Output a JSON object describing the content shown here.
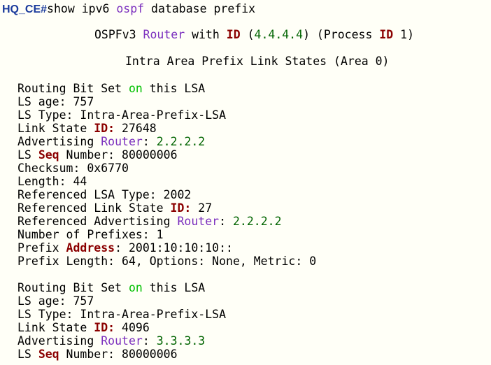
{
  "window": {
    "background": "#fffff7"
  },
  "colors": {
    "prompt": "#1a3a9c",
    "keyword_green": "#00c000",
    "keyword_purple": "#7b2fbe",
    "keyword_maroon": "#8b0000",
    "value_darkgreen": "#006400",
    "text": "#000000"
  },
  "terminal": {
    "lines": [
      {
        "name": "command-line",
        "segs": [
          {
            "t": "HQ_CE#",
            "c": "prompt"
          },
          {
            "t": "show ipv6 "
          },
          {
            "t": "ospf",
            "c": "purple"
          },
          {
            "t": " database prefix"
          }
        ]
      },
      {
        "name": "header-router-line",
        "segs": [
          {
            "t": "OSPFv3 "
          },
          {
            "t": "Router",
            "c": "purple"
          },
          {
            "t": " with "
          },
          {
            "t": "ID",
            "c": "maroon",
            "b": true
          },
          {
            "t": " ("
          },
          {
            "t": "4.4.4.4",
            "c": "darkgreen"
          },
          {
            "t": ") (Process "
          },
          {
            "t": "ID",
            "c": "maroon",
            "b": true
          },
          {
            "t": " 1)"
          }
        ]
      },
      {
        "name": "header-area-line",
        "segs": [
          {
            "t": "Intra Area Prefix Link States (Area 0)"
          }
        ]
      },
      {
        "name": "lsa1-routing-bit",
        "segs": [
          {
            "t": "Routing Bit Set "
          },
          {
            "t": "on",
            "c": "green"
          },
          {
            "t": " this LSA"
          }
        ]
      },
      {
        "name": "lsa1-ls-age",
        "segs": [
          {
            "t": "LS age: 757"
          }
        ]
      },
      {
        "name": "lsa1-ls-type",
        "segs": [
          {
            "t": "LS Type: Intra-Area-Prefix-LSA"
          }
        ]
      },
      {
        "name": "lsa1-link-state-id",
        "segs": [
          {
            "t": "Link State "
          },
          {
            "t": "ID:",
            "c": "maroon",
            "b": true
          },
          {
            "t": " 27648"
          }
        ]
      },
      {
        "name": "lsa1-advertising-router",
        "segs": [
          {
            "t": "Advertising "
          },
          {
            "t": "Router",
            "c": "purple"
          },
          {
            "t": ": "
          },
          {
            "t": "2.2.2.2",
            "c": "darkgreen"
          }
        ]
      },
      {
        "name": "lsa1-seq-number",
        "segs": [
          {
            "t": "LS "
          },
          {
            "t": "Seq",
            "c": "maroon",
            "b": true
          },
          {
            "t": " Number: 80000006"
          }
        ]
      },
      {
        "name": "lsa1-checksum",
        "segs": [
          {
            "t": "Checksum: 0x6770"
          }
        ]
      },
      {
        "name": "lsa1-length",
        "segs": [
          {
            "t": "Length: 44"
          }
        ]
      },
      {
        "name": "lsa1-ref-lsa-type",
        "segs": [
          {
            "t": "Referenced LSA Type: 2002"
          }
        ]
      },
      {
        "name": "lsa1-ref-link-state-id",
        "segs": [
          {
            "t": "Referenced Link State "
          },
          {
            "t": "ID:",
            "c": "maroon",
            "b": true
          },
          {
            "t": " 27"
          }
        ]
      },
      {
        "name": "lsa1-ref-adv-router",
        "segs": [
          {
            "t": "Referenced Advertising "
          },
          {
            "t": "Router",
            "c": "purple"
          },
          {
            "t": ": "
          },
          {
            "t": "2.2.2.2",
            "c": "darkgreen"
          }
        ]
      },
      {
        "name": "lsa1-num-prefixes",
        "segs": [
          {
            "t": "Number of Prefixes: 1"
          }
        ]
      },
      {
        "name": "lsa1-prefix-address",
        "segs": [
          {
            "t": "Prefix "
          },
          {
            "t": "Address",
            "c": "maroon",
            "b": true
          },
          {
            "t": ": 2001:10:10:10::"
          }
        ]
      },
      {
        "name": "lsa1-prefix-length",
        "segs": [
          {
            "t": "Prefix Length: 64, Options: None, Metric: 0"
          }
        ]
      },
      {
        "name": "lsa2-routing-bit",
        "segs": [
          {
            "t": "Routing Bit Set "
          },
          {
            "t": "on",
            "c": "green"
          },
          {
            "t": " this LSA"
          }
        ]
      },
      {
        "name": "lsa2-ls-age",
        "segs": [
          {
            "t": "LS age: 757"
          }
        ]
      },
      {
        "name": "lsa2-ls-type",
        "segs": [
          {
            "t": "LS Type: Intra-Area-Prefix-LSA"
          }
        ]
      },
      {
        "name": "lsa2-link-state-id",
        "segs": [
          {
            "t": "Link State "
          },
          {
            "t": "ID:",
            "c": "maroon",
            "b": true
          },
          {
            "t": " 4096"
          }
        ]
      },
      {
        "name": "lsa2-advertising-router",
        "segs": [
          {
            "t": "Advertising "
          },
          {
            "t": "Router",
            "c": "purple"
          },
          {
            "t": ": "
          },
          {
            "t": "3.3.3.3",
            "c": "darkgreen"
          }
        ]
      },
      {
        "name": "lsa2-seq-number",
        "segs": [
          {
            "t": "LS "
          },
          {
            "t": "Seq",
            "c": "maroon",
            "b": true
          },
          {
            "t": " Number: 80000006"
          }
        ]
      }
    ]
  }
}
